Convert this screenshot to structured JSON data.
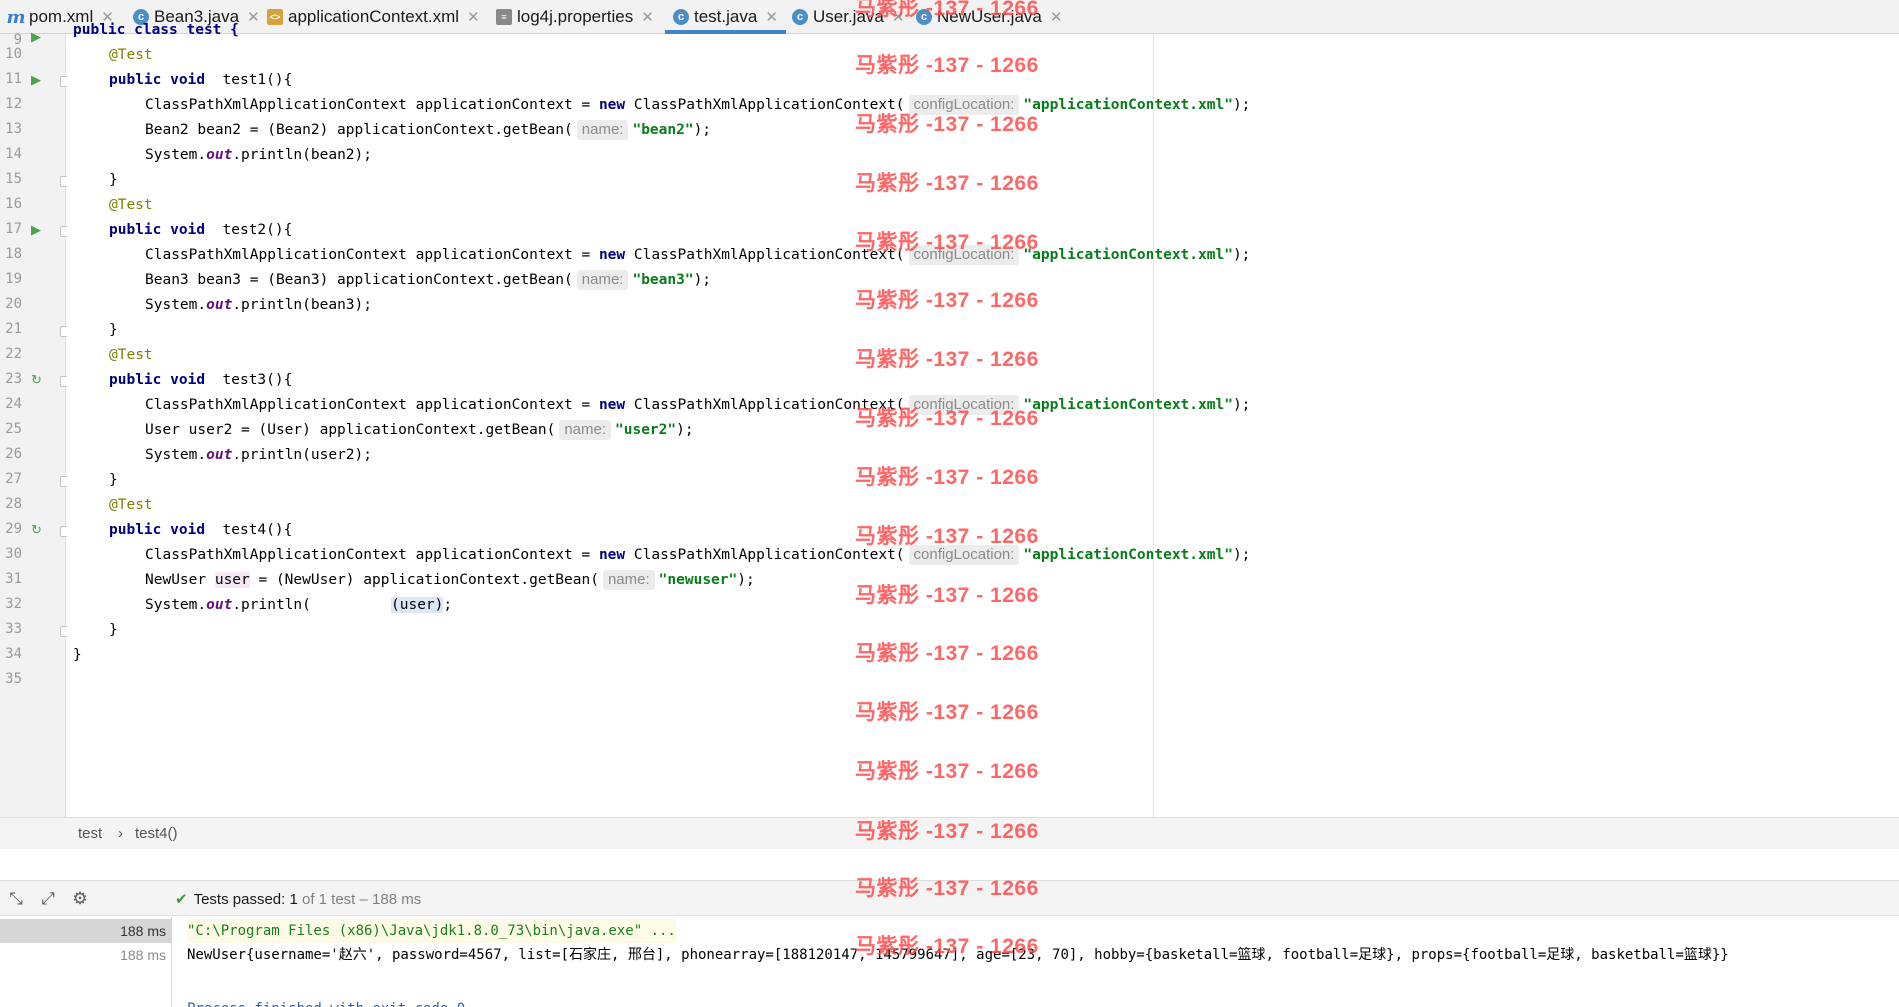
{
  "tabs": [
    {
      "icon": "m",
      "label": "pom.xml"
    },
    {
      "icon": "c",
      "label": "Bean3.java"
    },
    {
      "icon": "x",
      "label": "applicationContext.xml"
    },
    {
      "icon": "l",
      "label": "log4j.properties"
    },
    {
      "icon": "c",
      "label": "test.java",
      "active": true
    },
    {
      "icon": "c",
      "label": "User.java"
    },
    {
      "icon": "c",
      "label": "NewUser.java"
    }
  ],
  "code": {
    "line_numbers": [
      "10",
      "11",
      "12",
      "13",
      "14",
      "15",
      "16",
      "17",
      "18",
      "19",
      "20",
      "21",
      "22",
      "23",
      "24",
      "25",
      "26",
      "27",
      "28",
      "29",
      "30",
      "31",
      "32",
      "33",
      "34",
      "35"
    ],
    "ann_test": "@Test",
    "kw_public": "public",
    "kw_void": "void",
    "kw_new": "new",
    "m1": "test1(){",
    "m2": "test2(){",
    "m3": "test3(){",
    "m4": "test4(){",
    "ctx_prefix": "ClassPathXmlApplicationContext applicationContext = ",
    "ctx_ctor": "ClassPathXmlApplicationContext(",
    "hint_config": "configLocation:",
    "hint_name": "name:",
    "str_ctx": "\"applicationContext.xml\"",
    "end_paren": ");",
    "l13_pre": "Bean2 bean2 = (Bean2) applicationContext.getBean(",
    "l13_str": "\"bean2\"",
    "l19_pre": "Bean3 bean3 = (Bean3) applicationContext.getBean(",
    "l19_str": "\"bean3\"",
    "l25_pre": "User user2 = (User) applicationContext.getBean(",
    "l25_str": "\"user2\"",
    "l31_pre": "NewUser ",
    "l31_var": "user",
    "l31_mid": " = (NewUser) applicationContext.getBean(",
    "l31_str": "\"newuser\"",
    "sys": "System.",
    "out": "out",
    "println": ".println(",
    "p_bean2": "bean2);",
    "p_bean3": "bean3);",
    "p_user2": "user2);",
    "p_open": "(",
    "p_user": "user",
    "p_close": ")",
    "p_semi": ";",
    "close_brace": "}",
    "top_line": "public class test {"
  },
  "watermark": "马紫彤 -137 - 1266",
  "breadcrumb": [
    "test",
    "test4()"
  ],
  "breadcrumb_sep": "›",
  "run": {
    "status_prefix": "Tests passed: ",
    "status_count": "1",
    "status_rest": " of 1 test – 188 ms",
    "tree": [
      "188 ms",
      "188 ms"
    ],
    "console": [
      "\"C:\\Program Files (x86)\\Java\\jdk1.8.0_73\\bin\\java.exe\" ...",
      "NewUser{username='赵六', password=4567, list=[石家庄, 邢台], phonearray=[188120147, 145799647], age=[23, 70], hobby={basketall=篮球, football=足球}, props={football=足球, basketball=篮球}}",
      "Process finished with exit code 0"
    ]
  },
  "colors": {
    "accent": "#4083c9",
    "keyword": "#000080",
    "string": "#067d17",
    "annotation": "#808000",
    "watermark": "#ff4d4d"
  }
}
